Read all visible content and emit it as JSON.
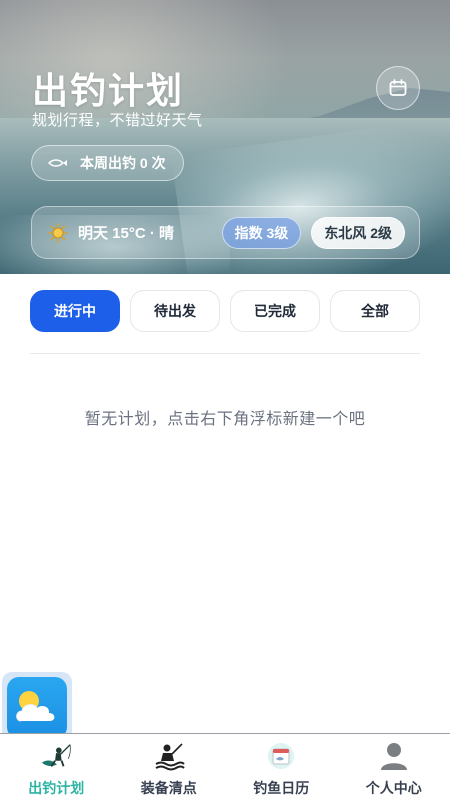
{
  "hero": {
    "title": "出钓计划",
    "subtitle": "规划行程，不错过好天气",
    "calendar_icon": "calendar-icon",
    "week_stat": "本周出钓 0 次",
    "weather": {
      "icon": "sun-icon",
      "text": "明天 15°C · 晴",
      "index_chip": "指数 3级",
      "wind_chip": "东北风 2级"
    }
  },
  "tabs": [
    {
      "label": "进行中",
      "active": true
    },
    {
      "label": "待出发",
      "active": false
    },
    {
      "label": "已完成",
      "active": false
    },
    {
      "label": "全部",
      "active": false
    }
  ],
  "empty_message": "暂无计划，点击右下角浮标新建一个吧",
  "floating_widget": {
    "icon": "weather-cloud-icon"
  },
  "bottom_nav": [
    {
      "label": "出钓计划",
      "icon": "angler-icon",
      "active": true
    },
    {
      "label": "装备清点",
      "icon": "fishing-gear-icon",
      "active": false
    },
    {
      "label": "钓鱼日历",
      "icon": "calendar-fish-icon",
      "active": false
    },
    {
      "label": "个人中心",
      "icon": "user-icon",
      "active": false
    }
  ],
  "colors": {
    "primary": "#1d5fe8",
    "nav_active": "#2bb3a3",
    "text_muted": "#6b7280"
  }
}
